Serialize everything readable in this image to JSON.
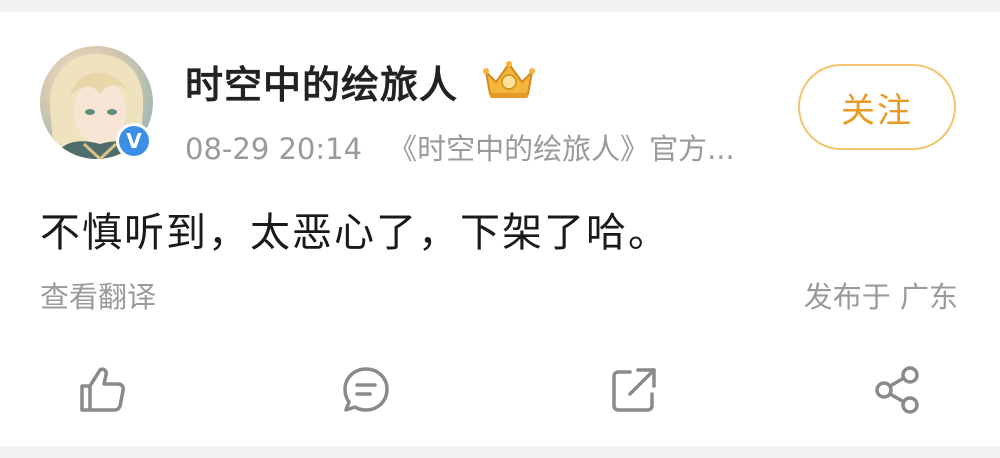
{
  "post": {
    "author": {
      "name": "时空中的绘旅人",
      "avatar": "avatar-illustration",
      "verified_badge": "V",
      "crown_badge": "crown-icon"
    },
    "meta": {
      "timestamp": "08-29 20:14",
      "source": "《时空中的绘旅人》官方..."
    },
    "follow_label": "关注",
    "text": "不慎听到，太恶心了，下架了哈。",
    "translate_label": "查看翻译",
    "location": "发布于 广东",
    "actions": {
      "like": "thumbs-up-icon",
      "comment": "comment-icon",
      "repost": "repost-icon",
      "share": "share-icon"
    }
  },
  "colors": {
    "follow_border": "#f3c46a",
    "follow_text": "#e89a24",
    "verified": "#3d8fe6",
    "meta_text": "#9a9a9a",
    "icon": "#8a8a8a"
  }
}
